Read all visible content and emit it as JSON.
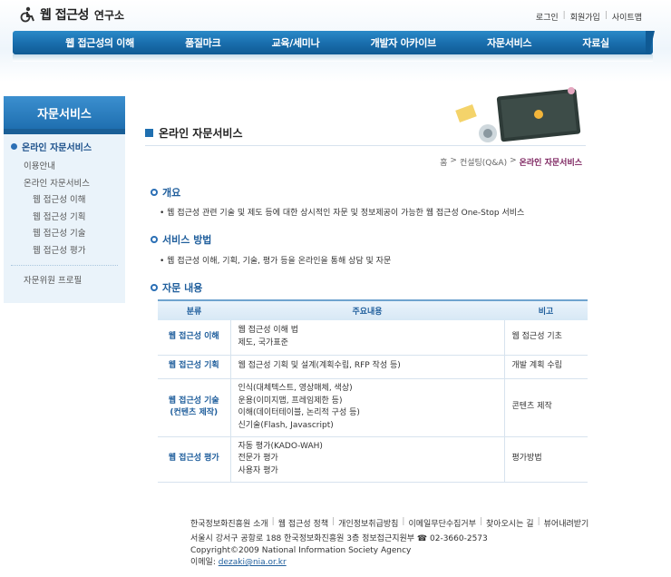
{
  "header": {
    "logo_main": "웹 접근성",
    "logo_sub": "연구소",
    "util_links": [
      "로그인",
      "회원가입",
      "사이트맵"
    ]
  },
  "gnb": [
    "웹 접근성의 이해",
    "품질마크",
    "교육/세미나",
    "개발자 아카이브",
    "자문서비스",
    "자료실"
  ],
  "lnb": {
    "title": "자문서비스",
    "active": "온라인 자문서비스",
    "items": [
      "이용안내",
      "온라인 자문서비스"
    ],
    "sub_items": [
      "웹 접근성 이해",
      "웹 접근성 기획",
      "웹 접근성 기술",
      "웹 접근성 평가"
    ],
    "last": "자문위원 프로필"
  },
  "page": {
    "title": "온라인 자문서비스",
    "breadcrumb": [
      "홈",
      "컨설팅(Q&A)",
      "온라인 자문서비스"
    ]
  },
  "sections": {
    "overview_title": "개요",
    "overview_text": "웹 접근성 관련 기술 및 제도 등에 대한 상시적인 자문 및 정보제공이 가능한 웹 접근성 One-Stop 서비스",
    "method_title": "서비스 방법",
    "method_text": "웹 접근성 이해, 기획, 기술, 평가 등을 온라인을 통해 상담 및 자문",
    "content_title": "자문 내용"
  },
  "table": {
    "headers": [
      "분류",
      "주요내용",
      "비고"
    ],
    "rows": [
      {
        "cat": [
          "웹 접근성 이해"
        ],
        "content": [
          "웹 접근성 이해 법",
          "제도, 국가표준"
        ],
        "note": "웹 접근성 기초"
      },
      {
        "cat": [
          "웹 접근성 기획"
        ],
        "content": [
          "웹 접근성 기획 및 설계(계획수립, RFP 작성 등)"
        ],
        "note": "개발 계획 수립"
      },
      {
        "cat": [
          "웹 접근성 기술",
          "(컨텐츠 제작)"
        ],
        "content": [
          "인식(대체텍스트, 영상매체, 색상)",
          "운용(이미지맵, 프레임제한 등)",
          "이해(데이터테이블, 논리적 구성 등)",
          "신기술(Flash, Javascript)"
        ],
        "note": "콘텐츠 제작"
      },
      {
        "cat": [
          "웹 접근성 평가"
        ],
        "content": [
          "자동 평가(KADO-WAH)",
          "전문가 평가",
          "사용자 평가"
        ],
        "note": "평가방법"
      }
    ]
  },
  "footer": {
    "links": [
      "한국정보화진흥원 소개",
      "웹 접근성 정책",
      "개인정보취급방침",
      "이메일무단수집거부",
      "찾아오시는 길",
      "뷰어내려받기"
    ],
    "address": "서울시 강서구 공항로 188 한국정보화진흥원 3층 정보접근지원부 ☎ 02-3660-2573",
    "copyright": "Copyright©2009 National Information Society Agency",
    "email_label": "이메일:",
    "email": "dezaki@nia.or.kr"
  },
  "colors": {
    "brand": "#1a6fae",
    "accent": "#7a1f5c"
  }
}
